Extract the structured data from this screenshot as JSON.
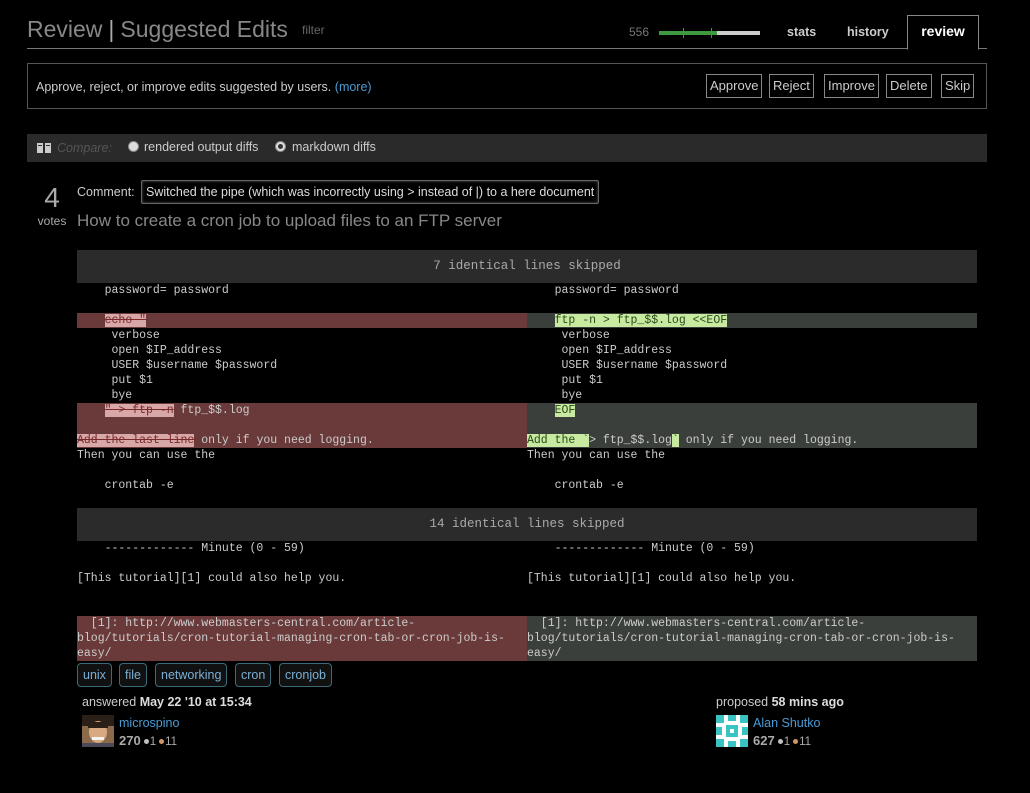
{
  "header": {
    "title_main": "Review",
    "title_sep": "|",
    "title_sub": "Suggested Edits",
    "filter_label": "filter",
    "count": "556",
    "progress": 0.57,
    "tabs": {
      "stats": "stats",
      "history": "history",
      "review": "review"
    }
  },
  "info": {
    "text": "Approve, reject, or improve edits suggested by users.",
    "more_link": "(more)",
    "buttons": {
      "approve": "Approve",
      "reject": "Reject",
      "improve": "Improve",
      "delete": "Delete",
      "skip": "Skip"
    }
  },
  "compare": {
    "label": "Compare:",
    "options": {
      "rendered": "rendered output diffs",
      "markdown": "markdown diffs"
    },
    "selected": "markdown"
  },
  "post": {
    "votes": "4",
    "votes_label": "votes",
    "comment_label": "Comment:",
    "comment": "Switched the pipe (which was incorrectly using > instead of |) to a here document",
    "title": "How to create a cron job to upload files to an FTP server"
  },
  "diff": {
    "skip1": "7 identical lines skipped",
    "skip2": "14 identical lines skipped",
    "left": {
      "l1": "    password= password",
      "del_echo": "echo \"",
      "l_verbose": "     verbose",
      "l_open": "     open $IP_address",
      "l_user": "     USER $username $password",
      "l_put": "     put $1",
      "l_bye": "     bye",
      "del_ftp": "\" > ftp -n",
      "l_log_tail": " ftp_$$.log",
      "del_addlast": "Add the last line",
      "l_only": " only if you need logging.",
      "l_then": "Then you can use the",
      "l_crontab": "    crontab -e",
      "l_minute": "    ------------- Minute (0 - 59)",
      "l_tutorial": "[This tutorial][1] could also help you.",
      "l_ref1": "  [1]: http://www.webmasters-central.com/article-",
      "l_ref2": "blog/tutorials/cron-tutorial-managing-cron-tab-or-cron-job-is-",
      "l_ref3": "easy/"
    },
    "right": {
      "l1": "    password= password",
      "ins_ftp": "ftp -n > ftp_$$.log <<EOF",
      "l_verbose": "     verbose",
      "l_open": "     open $IP_address",
      "l_user": "     USER $username $password",
      "l_put": "     put $1",
      "l_bye": "     bye",
      "ins_eof": "EOF",
      "ins_addthe": "Add the `",
      "l_log_mid": "> ftp_$$.log",
      "ins_tick": "`",
      "l_only": " only if you need logging.",
      "l_then": "Then you can use the",
      "l_crontab": "    crontab -e",
      "l_minute": "    ------------- Minute (0 - 59)",
      "l_tutorial": "[This tutorial][1] could also help you.",
      "l_ref1": "  [1]: http://www.webmasters-central.com/article-",
      "l_ref2": "blog/tutorials/cron-tutorial-managing-cron-tab-or-cron-job-is-",
      "l_ref3": "easy/"
    }
  },
  "tags": [
    "unix",
    "file",
    "networking",
    "cron",
    "cronjob"
  ],
  "answered": {
    "label": "answered",
    "date": "May 22 '10 at 15:34",
    "user": "microspino",
    "rep": "270",
    "silver": "1",
    "bronze": "11"
  },
  "proposed": {
    "label": "proposed",
    "time": "58 mins ago",
    "user": "Alan Shutko",
    "rep": "627",
    "silver": "1",
    "bronze": "11"
  },
  "colors": {
    "accent_link": "#4a9bd6",
    "deleted_bg": "#6a3a3a",
    "inserted_bg": "#3b3f3b",
    "progress": "#3f9a3f"
  }
}
